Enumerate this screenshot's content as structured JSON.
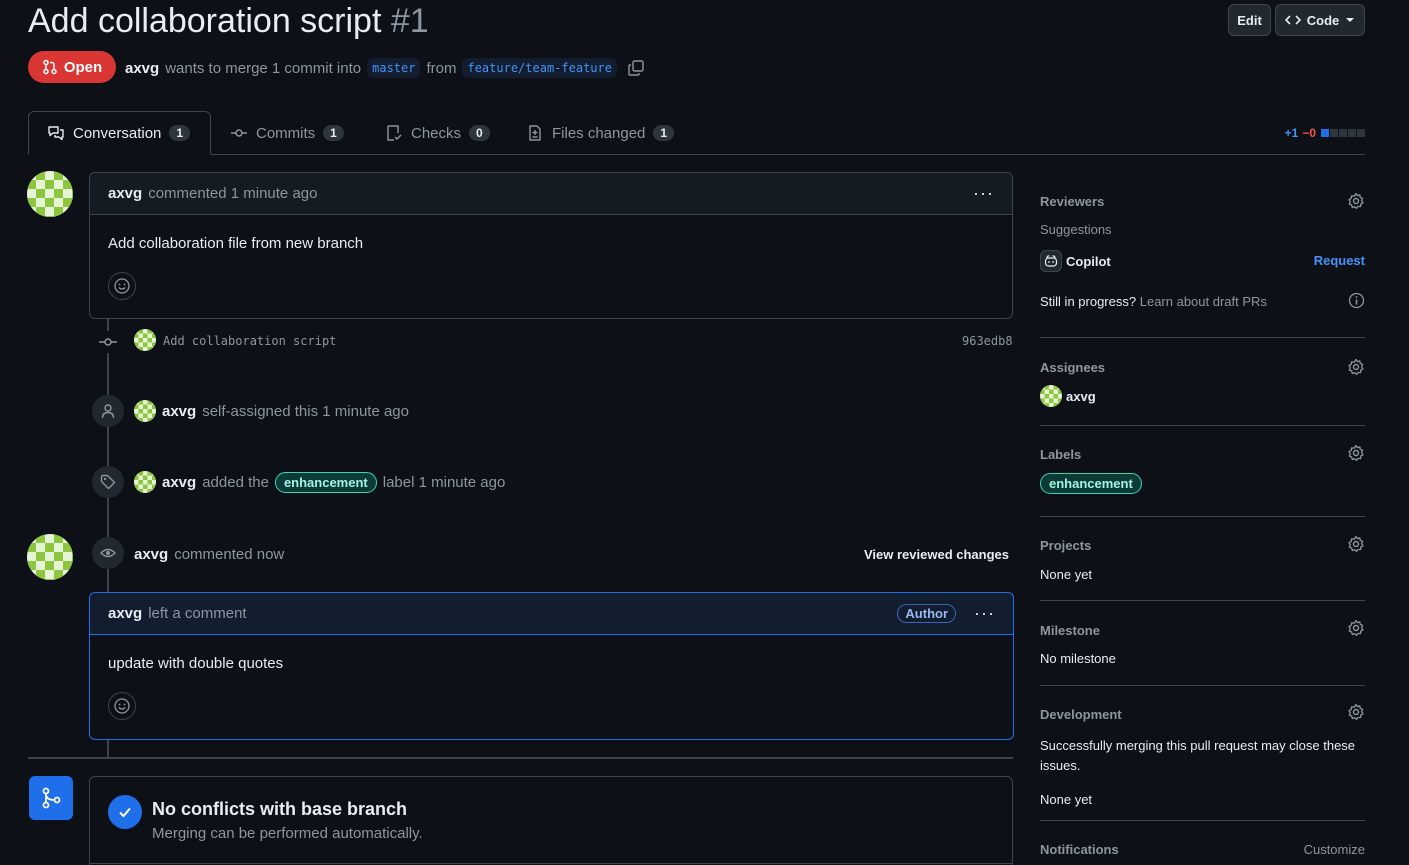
{
  "pr": {
    "title": "Add collaboration script",
    "number": "#1",
    "status": "Open",
    "author": "axvg",
    "merge_text": "wants to merge 1 commit into",
    "base_branch": "master",
    "from_text": "from",
    "head_branch": "feature/team-feature"
  },
  "header_buttons": {
    "edit": "Edit",
    "code": "Code"
  },
  "tabs": [
    {
      "label": "Conversation",
      "count": "1"
    },
    {
      "label": "Commits",
      "count": "1"
    },
    {
      "label": "Checks",
      "count": "0"
    },
    {
      "label": "Files changed",
      "count": "1"
    }
  ],
  "diffstat": {
    "added": "+1",
    "removed": "−0"
  },
  "first_comment": {
    "author": "axvg",
    "action": "commented 1 minute ago",
    "body": "Add collaboration file from new branch"
  },
  "commit": {
    "message": "Add collaboration script",
    "sha": "963edb8"
  },
  "events": {
    "self_assigned": {
      "author": "axvg",
      "text": "self-assigned this 1 minute ago"
    },
    "labeled": {
      "author": "axvg",
      "pre": "added the",
      "label": "enhancement",
      "post": "label 1 minute ago"
    }
  },
  "review": {
    "author": "axvg",
    "action": "commented now",
    "view_changes": "View reviewed changes",
    "comment_author": "axvg",
    "comment_action": "left a comment",
    "badge": "Author",
    "body": "update with double quotes"
  },
  "merge_box": {
    "title": "No conflicts with base branch",
    "subtitle": "Merging can be performed automatically."
  },
  "sidebar": {
    "reviewers": {
      "title": "Reviewers",
      "suggestions": "Suggestions",
      "copilot": "Copilot",
      "request": "Request",
      "draft_q": "Still in progress?",
      "draft_link": "Learn about draft PRs"
    },
    "assignees": {
      "title": "Assignees",
      "user": "axvg"
    },
    "labels": {
      "title": "Labels",
      "label": "enhancement"
    },
    "projects": {
      "title": "Projects",
      "value": "None yet"
    },
    "milestone": {
      "title": "Milestone",
      "value": "No milestone"
    },
    "development": {
      "title": "Development",
      "description": "Successfully merging this pull request may close these issues.",
      "value": "None yet"
    },
    "notifications": {
      "title": "Notifications",
      "customize": "Customize"
    }
  },
  "colors": {
    "background": "#0d1117",
    "open_badge": "#da3633",
    "accent": "#1f6feb",
    "label": "#39d3bb"
  }
}
